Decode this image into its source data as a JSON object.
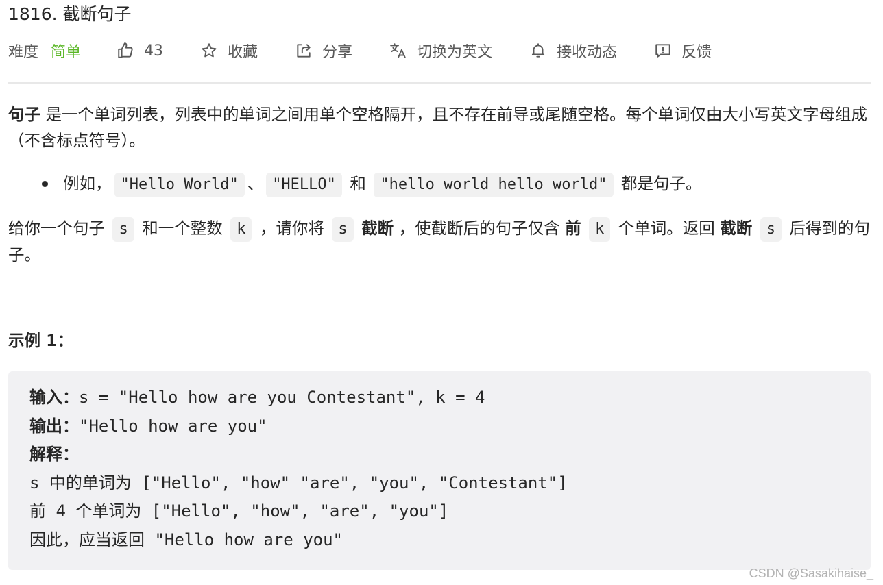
{
  "problem": {
    "title": "1816. 截断句子"
  },
  "toolbar": {
    "difficulty_label": "难度",
    "difficulty_value": "简单",
    "likes": "43",
    "favorite": "收藏",
    "share": "分享",
    "translate": "切换为英文",
    "notify": "接收动态",
    "feedback": "反馈"
  },
  "description": {
    "p1_bold": "句子",
    "p1_rest": " 是一个单词列表，列表中的单词之间用单个空格隔开，且不存在前导或尾随空格。每个单词仅由大小写英文字母组成（不含标点符号）。",
    "bullet_prefix": "例如，",
    "bullet_code1": "\"Hello World\"",
    "bullet_sep1": "、",
    "bullet_code2": "\"HELLO\"",
    "bullet_sep2": " 和 ",
    "bullet_code3": "\"hello world hello world\"",
    "bullet_suffix": " 都是句子。",
    "p2_a": "给你一个句子 ",
    "p2_code_s": "s",
    "p2_b": " 和一个整数 ",
    "p2_code_k": "k",
    "p2_c": " ，请你将 ",
    "p2_d_bold": "截断",
    "p2_e": " ，使截断后的句子仅含 ",
    "p2_f_bold": "前",
    "p2_g": " 个单词。返回 ",
    "p2_h_bold": "截断",
    "p2_i": " 后得到的句子。"
  },
  "example": {
    "title": "示例 1：",
    "input_label": "输入：",
    "input_value": "s = \"Hello how are you Contestant\", k = 4",
    "output_label": "输出：",
    "output_value": "\"Hello how are you\"",
    "explain_label": "解释：",
    "line1_a": "s ",
    "line1_b": "中的单词为",
    "line1_c": " [\"Hello\", \"how\" \"are\", \"you\", \"Contestant\"]",
    "line2_a": "前",
    "line2_b": " 4 ",
    "line2_c": "个单词为",
    "line2_d": " [\"Hello\", \"how\", \"are\", \"you\"]",
    "line3_a": "因此，应当返回",
    "line3_b": " \"Hello how are you\""
  },
  "watermark": "CSDN @Sasakihaise_",
  "colors": {
    "difficulty_easy": "#5ab726",
    "code_bg": "#f1f1f1",
    "example_bg": "#f1f1f3"
  }
}
